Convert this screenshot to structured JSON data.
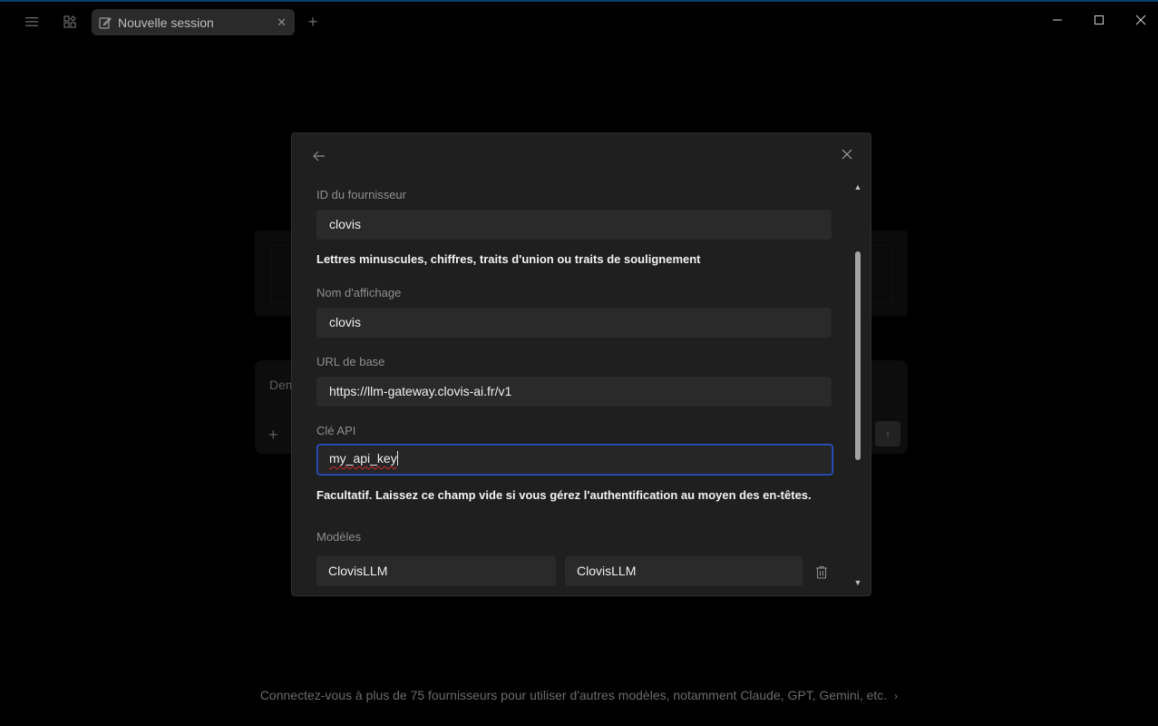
{
  "titlebar": {
    "tab_label": "Nouvelle session",
    "icons": [
      "menu-icon",
      "apps-grid-icon",
      "edit-icon",
      "close-icon",
      "plus-icon",
      "minimize-icon",
      "maximize-icon",
      "close-window-icon"
    ]
  },
  "background": {
    "input_placeholder": "Dem",
    "footer_text": "Connectez-vous à plus de 75 fournisseurs pour utiliser d'autres modèles, notamment Claude, GPT, Gemini, etc."
  },
  "modal": {
    "provider_id": {
      "label": "ID du fournisseur",
      "value": "clovis",
      "helper": "Lettres minuscules, chiffres, traits d'union ou traits de soulignement"
    },
    "display_name": {
      "label": "Nom d'affichage",
      "value": "clovis"
    },
    "base_url": {
      "label": "URL de base",
      "value": "https://llm-gateway.clovis-ai.fr/v1"
    },
    "api_key": {
      "label": "Clé API",
      "value": "my_api_key",
      "helper": "Facultatif. Laissez ce champ vide si vous gérez l'authentification au moyen des en-têtes."
    },
    "models": {
      "label": "Modèles",
      "rows": [
        {
          "id": "ClovisLLM",
          "name": "ClovisLLM"
        }
      ]
    }
  },
  "colors": {
    "background": "#000000",
    "modal_bg": "#1f1f1f",
    "input_bg": "#2a2a2a",
    "focus_border": "#2f56c9",
    "accent_topline": "#0d3c6e"
  }
}
